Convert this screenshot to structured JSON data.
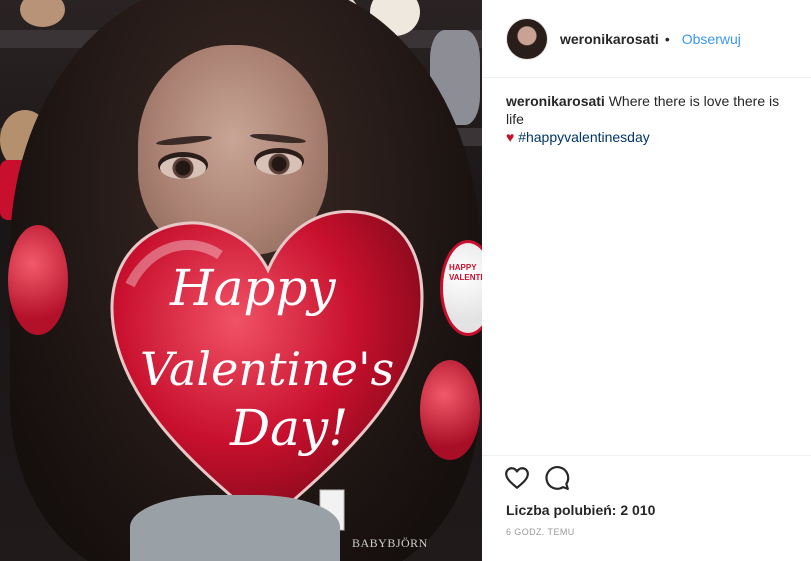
{
  "post": {
    "username": "weronikarosati",
    "separator": "•",
    "follow_label": "Obserwuj",
    "caption": {
      "text": "Where there is love there is life",
      "emoji": "♥",
      "hashtag": "#happyvalentinesday"
    },
    "likes_text": "Liczba polubień: 2 010",
    "timestamp": "6 GODZ. TEMU"
  },
  "photo": {
    "balloon_lines": [
      "Happy",
      "Valentine's",
      "Day!"
    ],
    "side_balloon_lines": [
      "HAPPY",
      "VALENTINE'S"
    ],
    "brand": "BABYBJÖRN"
  },
  "icons": {
    "like": "heart-outline-icon",
    "comment": "comment-bubble-icon"
  },
  "colors": {
    "follow": "#3897f0",
    "hashtag": "#003569",
    "balloon": "#c8102e"
  }
}
